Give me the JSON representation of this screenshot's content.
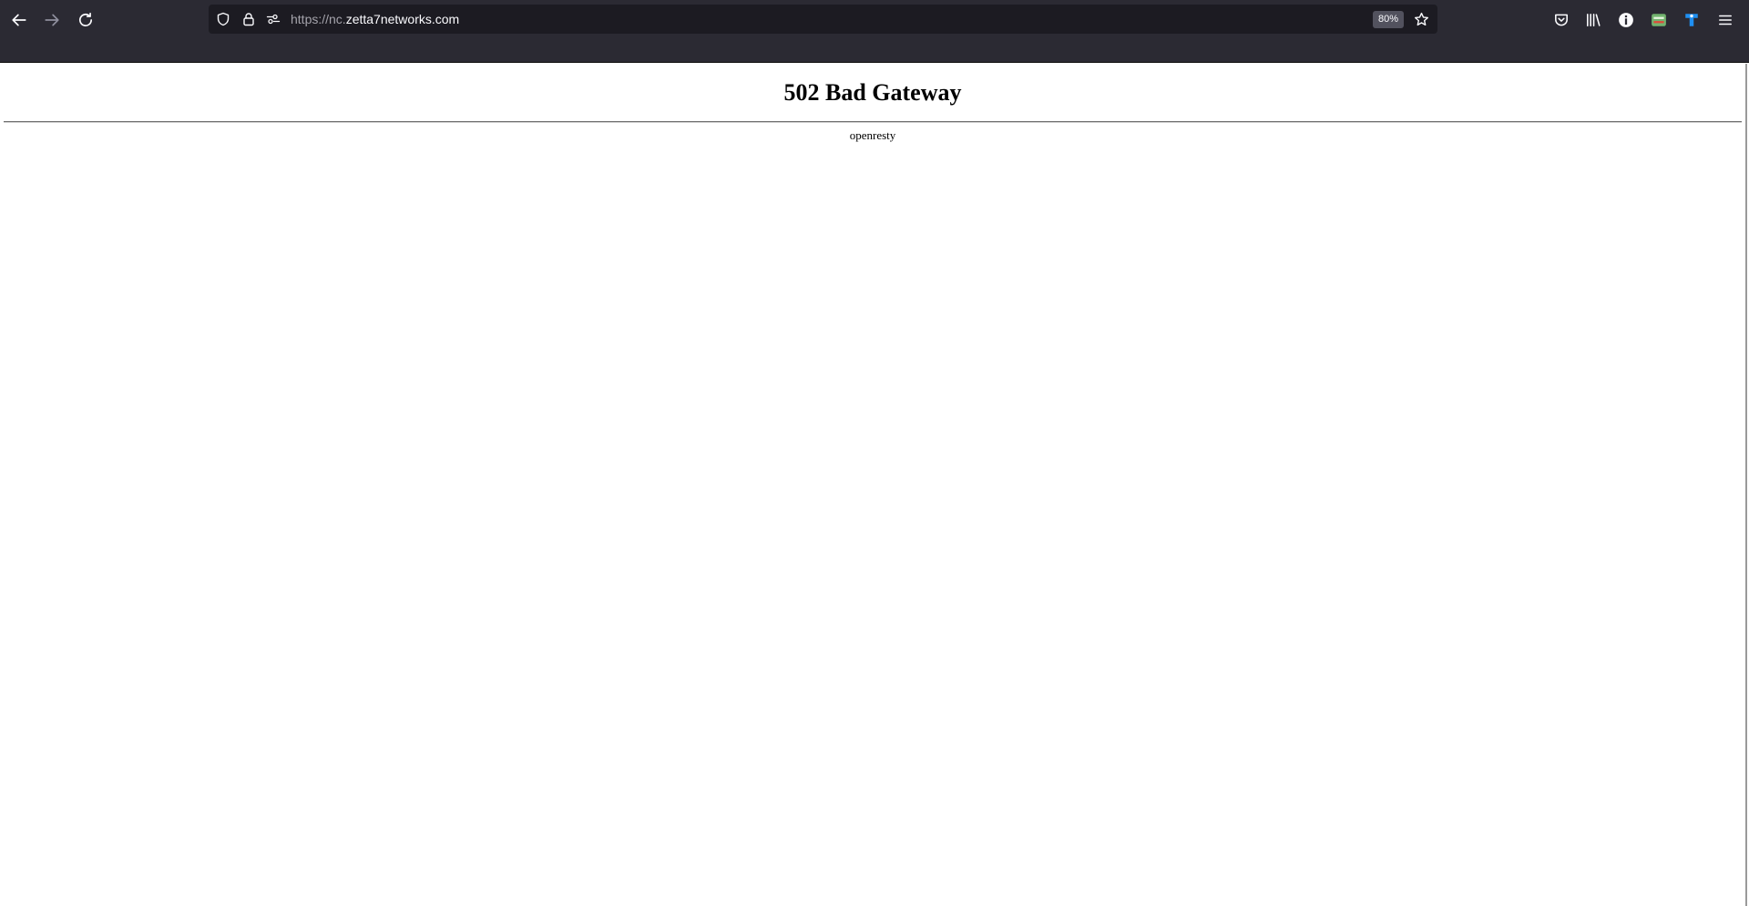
{
  "browser": {
    "nav": {
      "back_icon": "arrow-left-icon",
      "forward_icon": "arrow-right-icon",
      "reload_icon": "reload-icon"
    },
    "urlbar": {
      "scheme": "https://nc.",
      "host": "zetta7networks.com",
      "zoom": "80%",
      "icons": [
        "shield-icon",
        "lock-icon",
        "permissions-icon",
        "star-icon"
      ]
    },
    "toolbar_icons": [
      "pocket-icon",
      "library-icon",
      "info-icon",
      "extension-green-icon",
      "extension-blue-icon",
      "menu-icon"
    ],
    "colors": {
      "chrome": "#2b2a33",
      "urlbar": "#1c1b22",
      "accent_blue": "#1f8ff2",
      "ext_green": "#73b36f"
    }
  },
  "page": {
    "title": "502 Bad Gateway",
    "server": "openresty"
  }
}
